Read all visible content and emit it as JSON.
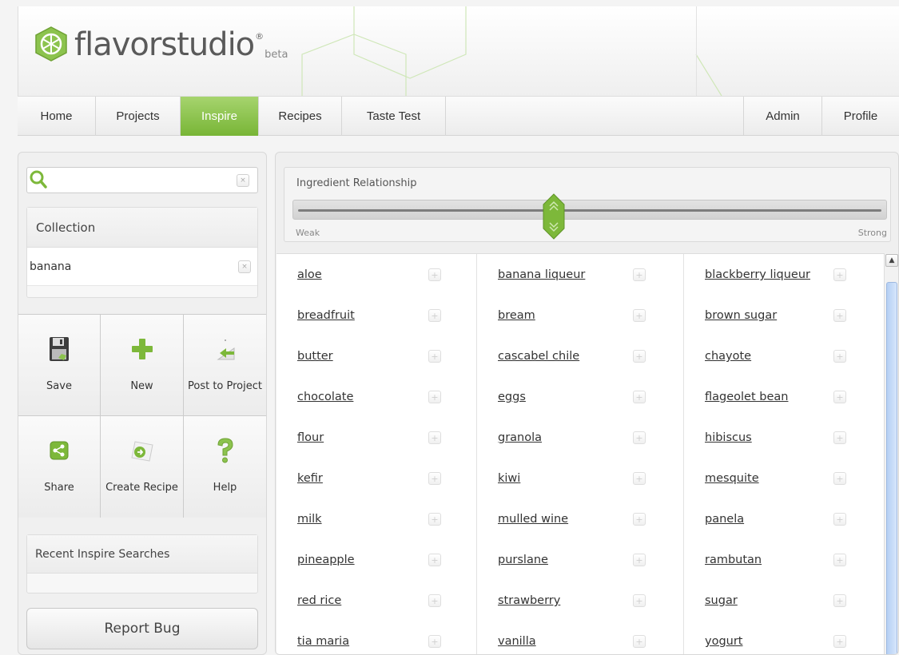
{
  "app": {
    "logo_text": "flavorstudio",
    "logo_reg": "®",
    "logo_beta": "beta"
  },
  "nav": {
    "left": [
      {
        "label": "Home",
        "active": false
      },
      {
        "label": "Projects",
        "active": false
      },
      {
        "label": "Inspire",
        "active": true
      },
      {
        "label": "Recipes",
        "active": false
      },
      {
        "label": "Taste Test",
        "active": false
      }
    ],
    "right": [
      {
        "label": "Admin"
      },
      {
        "label": "Profile"
      }
    ]
  },
  "sidebar": {
    "search": {
      "value": "",
      "placeholder": "",
      "clear_label": "×"
    },
    "collection": {
      "title": "Collection",
      "items": [
        {
          "label": "banana",
          "remove_label": "×"
        }
      ]
    },
    "actions": [
      {
        "label": "Save",
        "icon": "floppy-disk-icon"
      },
      {
        "label": "New",
        "icon": "plus-icon"
      },
      {
        "label": "Post to Project",
        "icon": "post-arrow-icon"
      },
      {
        "label": "Share",
        "icon": "share-icon"
      },
      {
        "label": "Create Recipe",
        "icon": "create-recipe-icon"
      },
      {
        "label": "Help",
        "icon": "question-mark-icon"
      }
    ],
    "recent_title": "Recent Inspire Searches",
    "report_bug": "Report Bug"
  },
  "relationship": {
    "title": "Ingredient Relationship",
    "weak_label": "Weak",
    "strong_label": "Strong",
    "level": 0.44
  },
  "ingredients": {
    "add_label": "+",
    "columns": [
      [
        "aloe",
        "breadfruit",
        "butter",
        "chocolate",
        "flour",
        "kefir",
        "milk",
        "pineapple",
        "red rice",
        "tia maria"
      ],
      [
        "banana liqueur",
        "bream",
        "cascabel chile",
        "eggs",
        "granola",
        "kiwi",
        "mulled wine",
        "purslane",
        "strawberry",
        "vanilla"
      ],
      [
        "blackberry liqueur",
        "brown sugar",
        "chayote",
        "flageolet bean",
        "hibiscus",
        "mesquite",
        "panela",
        "rambutan",
        "sugar",
        "yogurt"
      ]
    ]
  },
  "colors": {
    "accent_green": "#8cc34e",
    "nav_active": "#78b536",
    "scroll_thumb": "#c4daf8"
  }
}
